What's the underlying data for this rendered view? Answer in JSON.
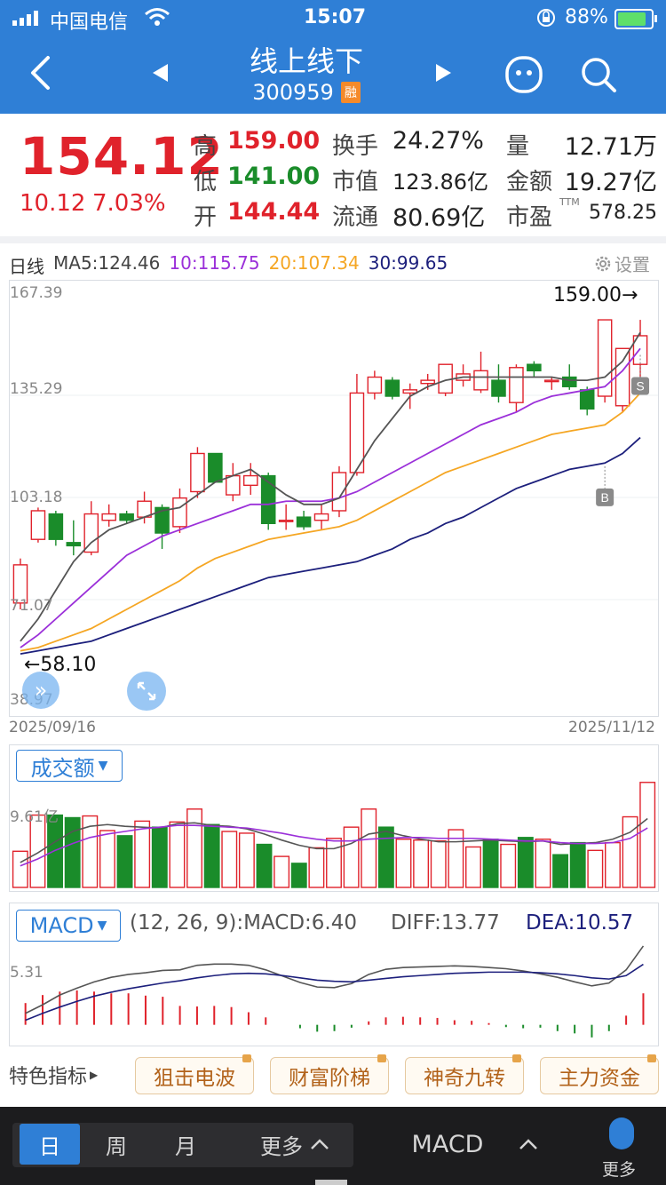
{
  "status_bar": {
    "carrier": "中国电信",
    "time": "15:07",
    "battery": "88%"
  },
  "nav": {
    "title": "线上线下",
    "code": "300959",
    "badge": "融",
    "icons": [
      "back-icon",
      "prev-triangle-icon",
      "next-triangle-icon",
      "face-icon",
      "search-icon"
    ]
  },
  "quote": {
    "price": "154.12",
    "change": "10.12",
    "change_pct": "7.03%",
    "high_label": "高",
    "high": "159.00",
    "low_label": "低",
    "low": "141.00",
    "open_label": "开",
    "open": "144.44",
    "turnover_label": "换手",
    "turnover": "24.27%",
    "mktcap_label": "市值",
    "mktcap": "123.86亿",
    "float_label": "流通",
    "float": "80.69亿",
    "volume_label": "量",
    "volume": "12.71万",
    "amount_label": "金额",
    "amount": "19.27亿",
    "pe_label": "市盈",
    "pe_sup": "TTM",
    "pe": "578.25"
  },
  "kline_header": {
    "period": "日线",
    "ma5": "MA5:124.46",
    "ma10": "10:115.75",
    "ma20": "20:107.34",
    "ma30": "30:99.65",
    "settings": "设置"
  },
  "colors": {
    "up": "#e0222b",
    "down": "#1a8c2a",
    "ma5": "#555555",
    "ma10": "#9b30d9",
    "ma20": "#f5a623",
    "ma30": "#1c1f7c",
    "accent": "#2f7fd6"
  },
  "chart_data": [
    {
      "type": "candlestick",
      "y_ticks": [
        "167.39",
        "135.29",
        "103.18",
        "71.07",
        "38.97"
      ],
      "ylim": [
        38.97,
        167.39
      ],
      "x_start": "2025/09/16",
      "x_end": "2025/11/12",
      "max_annotation": "159.00→",
      "min_annotation": "←58.10",
      "markers": [
        "S",
        "B"
      ],
      "candles": [
        {
          "o": 70,
          "c": 82,
          "h": 84,
          "l": 68
        },
        {
          "o": 90,
          "c": 99,
          "h": 100,
          "l": 89
        },
        {
          "o": 98,
          "c": 90,
          "h": 99,
          "l": 88
        },
        {
          "o": 89,
          "c": 88,
          "h": 96,
          "l": 85
        },
        {
          "o": 86,
          "c": 98,
          "h": 102,
          "l": 85
        },
        {
          "o": 96,
          "c": 98,
          "h": 101,
          "l": 94
        },
        {
          "o": 98,
          "c": 96,
          "h": 99,
          "l": 95
        },
        {
          "o": 97,
          "c": 102,
          "h": 105,
          "l": 95
        },
        {
          "o": 100,
          "c": 92,
          "h": 101,
          "l": 87
        },
        {
          "o": 94,
          "c": 103,
          "h": 106,
          "l": 92
        },
        {
          "o": 105,
          "c": 117,
          "h": 119,
          "l": 103
        },
        {
          "o": 117,
          "c": 108,
          "h": 117,
          "l": 108
        },
        {
          "o": 104,
          "c": 110,
          "h": 114,
          "l": 102
        },
        {
          "o": 107,
          "c": 110,
          "h": 114,
          "l": 104
        },
        {
          "o": 110,
          "c": 95,
          "h": 111,
          "l": 93
        },
        {
          "o": 96,
          "c": 96,
          "h": 101,
          "l": 93
        },
        {
          "o": 97,
          "c": 94,
          "h": 99,
          "l": 93
        },
        {
          "o": 96,
          "c": 98,
          "h": 101,
          "l": 93
        },
        {
          "o": 99,
          "c": 111,
          "h": 113,
          "l": 97
        },
        {
          "o": 111,
          "c": 136,
          "h": 142,
          "l": 110
        },
        {
          "o": 136,
          "c": 141,
          "h": 143,
          "l": 134
        },
        {
          "o": 140,
          "c": 135,
          "h": 141,
          "l": 134
        },
        {
          "o": 136,
          "c": 137,
          "h": 139,
          "l": 131
        },
        {
          "o": 139,
          "c": 140,
          "h": 142,
          "l": 137
        },
        {
          "o": 136,
          "c": 145,
          "h": 145,
          "l": 135
        },
        {
          "o": 140,
          "c": 142,
          "h": 145,
          "l": 138
        },
        {
          "o": 137,
          "c": 143,
          "h": 149,
          "l": 136
        },
        {
          "o": 140,
          "c": 135,
          "h": 145,
          "l": 133
        },
        {
          "o": 133,
          "c": 144,
          "h": 145,
          "l": 130
        },
        {
          "o": 145,
          "c": 143,
          "h": 146,
          "l": 141
        },
        {
          "o": 140,
          "c": 140,
          "h": 141,
          "l": 137
        },
        {
          "o": 141,
          "c": 138,
          "h": 145,
          "l": 137
        },
        {
          "o": 137,
          "c": 131,
          "h": 138,
          "l": 129
        },
        {
          "o": 135,
          "c": 159,
          "h": 159,
          "l": 133
        },
        {
          "o": 132,
          "c": 150,
          "h": 150,
          "l": 130
        },
        {
          "o": 145,
          "c": 154,
          "h": 159,
          "l": 141
        }
      ],
      "ma5": [
        58,
        65,
        74,
        83,
        89,
        93,
        95,
        97,
        99,
        100,
        104,
        108,
        110,
        112,
        108,
        104,
        101,
        101,
        103,
        112,
        121,
        128,
        135,
        138,
        140,
        141,
        141,
        141,
        141,
        141,
        141,
        140,
        140,
        141,
        146,
        155
      ],
      "ma10": [
        56,
        60,
        65,
        70,
        75,
        80,
        85,
        88,
        91,
        93,
        95,
        97,
        99,
        101,
        101,
        102,
        102,
        102,
        103,
        105,
        108,
        111,
        114,
        117,
        120,
        123,
        126,
        128,
        130,
        133,
        135,
        136,
        137,
        138,
        143,
        150
      ],
      "ma20": [
        55,
        56,
        58,
        60,
        62,
        65,
        68,
        71,
        74,
        77,
        81,
        84,
        86,
        88,
        90,
        91,
        92,
        93,
        94,
        96,
        99,
        102,
        105,
        108,
        111,
        113,
        115,
        117,
        119,
        121,
        123,
        124,
        125,
        126,
        130,
        136
      ],
      "ma30": [
        54,
        55,
        56,
        57,
        58,
        60,
        62,
        64,
        66,
        68,
        70,
        72,
        74,
        76,
        78,
        79,
        80,
        81,
        82,
        83,
        85,
        87,
        90,
        92,
        95,
        97,
        100,
        103,
        106,
        108,
        110,
        112,
        113,
        114,
        117,
        122
      ]
    },
    {
      "type": "bar",
      "title": "成交额",
      "y_tick": "9.61亿",
      "values": [
        4.2,
        8.4,
        8.4,
        8.1,
        8.3,
        6.6,
        6.0,
        7.7,
        7.0,
        7.6,
        9.1,
        7.3,
        6.5,
        6.3,
        5.0,
        3.6,
        2.8,
        4.6,
        5.7,
        7.0,
        9.1,
        7.0,
        5.6,
        5.5,
        5.4,
        6.7,
        4.7,
        5.6,
        5.0,
        5.8,
        5.6,
        3.8,
        5.2,
        4.3,
        5.2,
        8.2,
        12.2
      ],
      "ma_lines": [
        [
          2.9,
          4.0,
          5.3,
          6.5,
          7.1,
          7.3,
          7.1,
          7.0,
          6.9,
          7.4,
          7.5,
          7.2,
          7.1,
          6.8,
          6.2,
          5.5,
          4.9,
          4.5,
          4.5,
          5.1,
          6.2,
          6.5,
          6.0,
          5.6,
          5.3,
          5.3,
          5.4,
          5.5,
          5.4,
          5.3,
          5.4,
          5.0,
          5.1,
          5.2,
          5.6,
          6.4,
          8.0
        ],
        [
          2.5,
          3.3,
          4.3,
          5.1,
          5.8,
          6.2,
          6.5,
          6.8,
          7.0,
          7.2,
          7.2,
          7.1,
          7.0,
          6.9,
          6.6,
          6.3,
          5.9,
          5.6,
          5.4,
          5.4,
          5.6,
          5.7,
          5.8,
          5.8,
          5.7,
          5.7,
          5.7,
          5.6,
          5.5,
          5.4,
          5.4,
          5.2,
          5.1,
          5.1,
          5.2,
          5.7,
          6.9
        ]
      ]
    },
    {
      "type": "bar",
      "title": "MACD",
      "params": "(12, 26, 9):MACD:6.40",
      "diff": "DIFF:13.77",
      "dea": "DEA:10.57",
      "y_tick": "5.31",
      "values": [
        3.8,
        5.2,
        5.8,
        6.0,
        5.8,
        5.5,
        5.5,
        5.1,
        4.9,
        3.3,
        3.2,
        3.3,
        3.1,
        2.2,
        1.3,
        0.0,
        -0.6,
        -1.2,
        -1.1,
        -0.5,
        0.6,
        1.3,
        1.4,
        1.3,
        1.2,
        0.8,
        0.7,
        0.3,
        -0.4,
        -0.6,
        -0.5,
        -1.1,
        -1.5,
        -2.2,
        -1.1,
        1.6,
        5.5
      ],
      "diff_values": [
        2.0,
        3.5,
        5.2,
        6.4,
        7.5,
        8.3,
        8.8,
        9.1,
        9.5,
        9.6,
        10.4,
        10.6,
        10.6,
        10.4,
        9.6,
        8.5,
        7.4,
        6.6,
        6.5,
        7.2,
        8.8,
        9.7,
        10.0,
        10.1,
        10.2,
        10.3,
        10.2,
        10.0,
        9.8,
        9.4,
        8.9,
        8.3,
        7.5,
        6.8,
        7.3,
        9.6,
        13.77
      ],
      "dea_values": [
        0.8,
        2.0,
        3.1,
        4.1,
        5.0,
        5.7,
        6.3,
        6.8,
        7.3,
        7.7,
        8.2,
        8.6,
        8.9,
        9.0,
        8.9,
        8.6,
        8.2,
        7.8,
        7.6,
        7.5,
        7.8,
        8.1,
        8.4,
        8.6,
        8.8,
        9.0,
        9.1,
        9.2,
        9.2,
        9.2,
        9.1,
        8.9,
        8.6,
        8.2,
        8.0,
        8.6,
        10.57
      ]
    }
  ],
  "features": {
    "label": "特色指标",
    "buttons": [
      "狙击电波",
      "财富阶梯",
      "神奇九转",
      "主力资金"
    ]
  },
  "bottom": {
    "tabs": [
      "日",
      "周",
      "月",
      "更多"
    ],
    "active": "日",
    "indicator": "MACD",
    "more": "更多"
  }
}
